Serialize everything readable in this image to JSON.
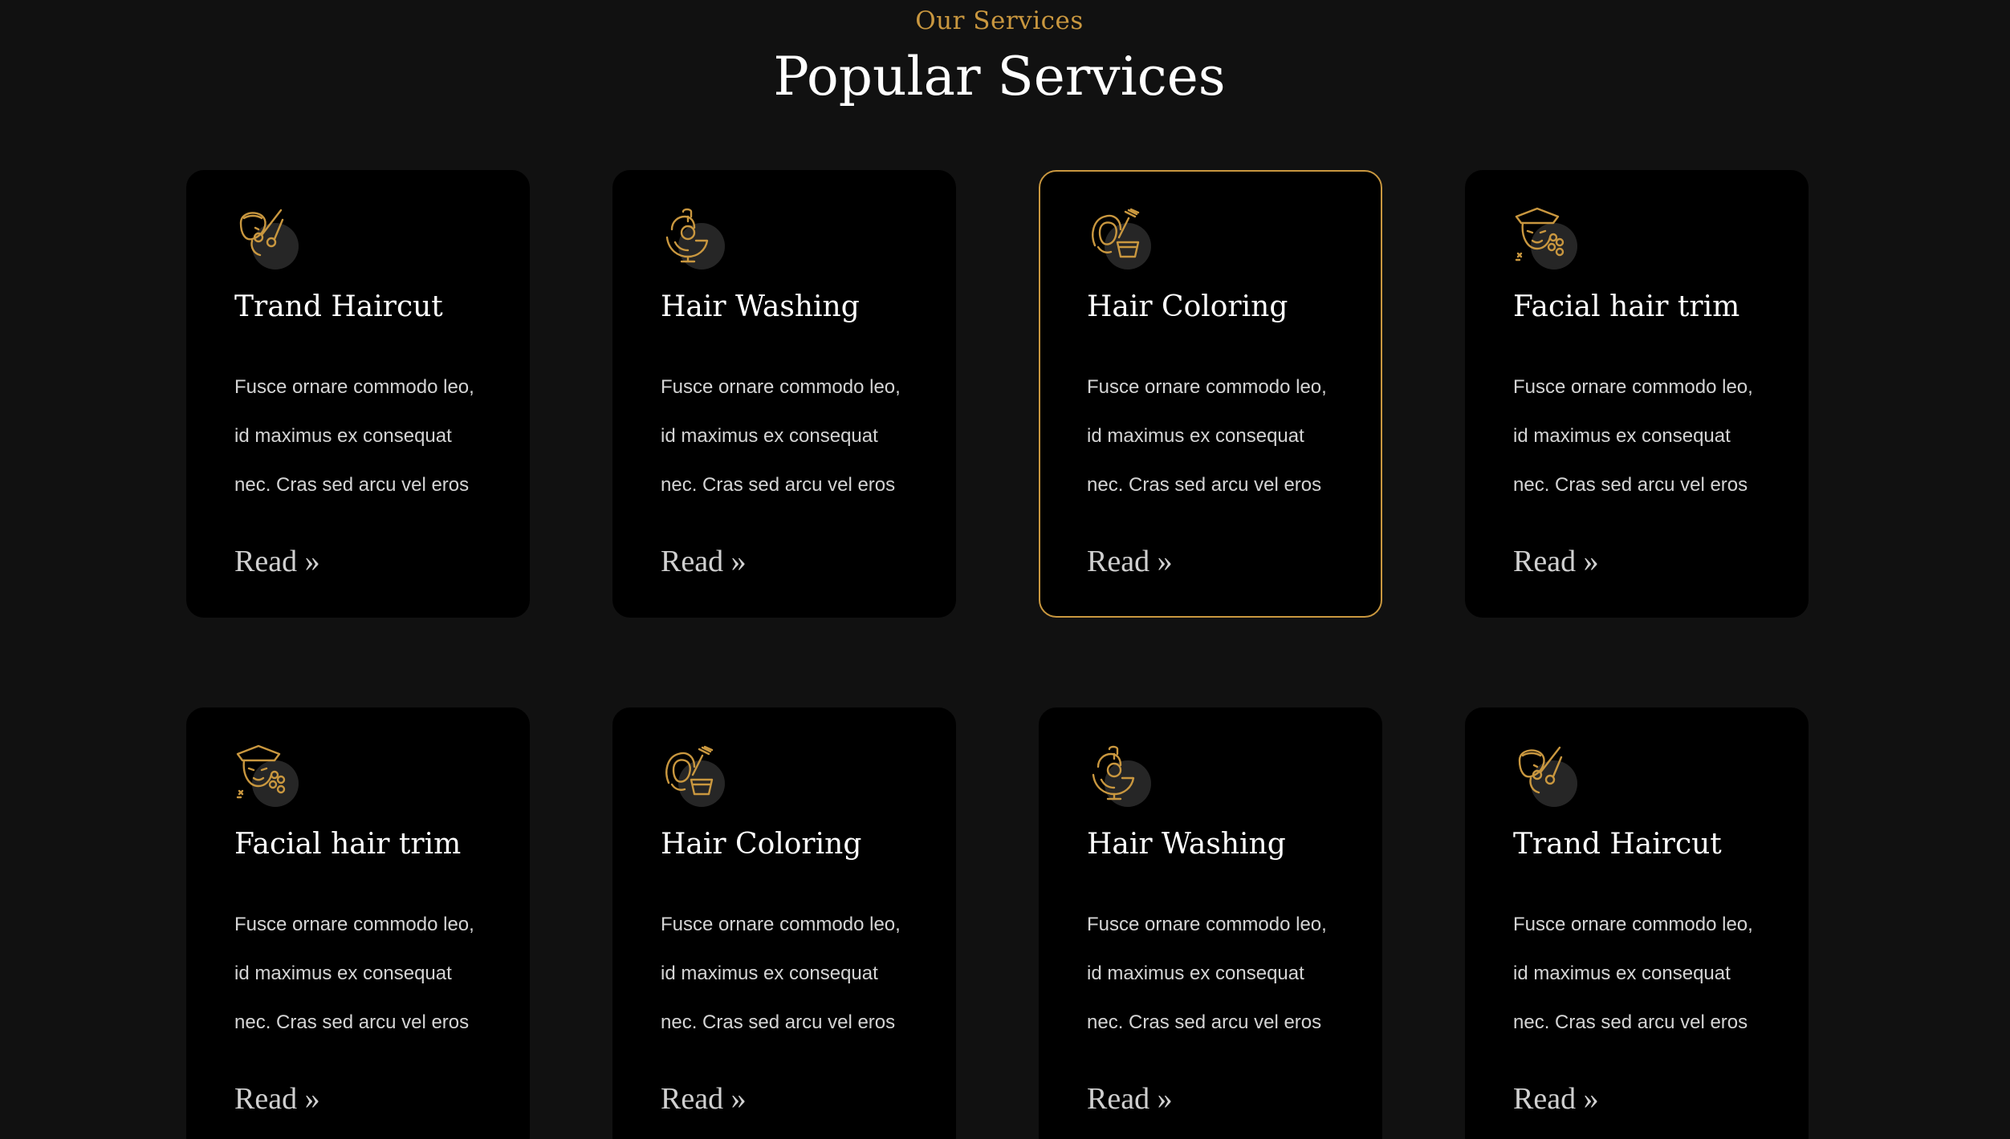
{
  "section": {
    "eyebrow": "Our Services",
    "title": "Popular Services"
  },
  "colors": {
    "accent": "#c9973f",
    "background": "#111111",
    "card": "#000000"
  },
  "cards": [
    {
      "icon": "haircut-scissors-icon",
      "title": "Trand Haircut",
      "desc": [
        "Fusce ornare commodo leo,",
        "id maximus ex consequat",
        "nec. Cras sed arcu vel eros"
      ],
      "link": "Read »",
      "active": false
    },
    {
      "icon": "hair-washing-icon",
      "title": "Hair Washing",
      "desc": [
        "Fusce ornare commodo leo,",
        "id maximus ex consequat",
        "nec. Cras sed arcu vel eros"
      ],
      "link": "Read »",
      "active": false
    },
    {
      "icon": "hair-coloring-icon",
      "title": "Hair Coloring",
      "desc": [
        "Fusce ornare commodo leo,",
        "id maximus ex consequat",
        "nec. Cras sed arcu vel eros"
      ],
      "link": "Read »",
      "active": true
    },
    {
      "icon": "facial-treatment-icon",
      "title": "Facial hair trim",
      "desc": [
        "Fusce ornare commodo leo,",
        "id maximus ex consequat",
        "nec. Cras sed arcu vel eros"
      ],
      "link": "Read »",
      "active": false
    },
    {
      "icon": "facial-treatment-icon",
      "title": "Facial hair trim",
      "desc": [
        "Fusce ornare commodo leo,",
        "id maximus ex consequat",
        "nec. Cras sed arcu vel eros"
      ],
      "link": "Read »",
      "active": false
    },
    {
      "icon": "hair-coloring-icon",
      "title": "Hair Coloring",
      "desc": [
        "Fusce ornare commodo leo,",
        "id maximus ex consequat",
        "nec. Cras sed arcu vel eros"
      ],
      "link": "Read »",
      "active": false
    },
    {
      "icon": "hair-washing-icon",
      "title": "Hair Washing",
      "desc": [
        "Fusce ornare commodo leo,",
        "id maximus ex consequat",
        "nec. Cras sed arcu vel eros"
      ],
      "link": "Read »",
      "active": false
    },
    {
      "icon": "haircut-scissors-icon",
      "title": "Trand Haircut",
      "desc": [
        "Fusce ornare commodo leo,",
        "id maximus ex consequat",
        "nec. Cras sed arcu vel eros"
      ],
      "link": "Read »",
      "active": false
    }
  ]
}
